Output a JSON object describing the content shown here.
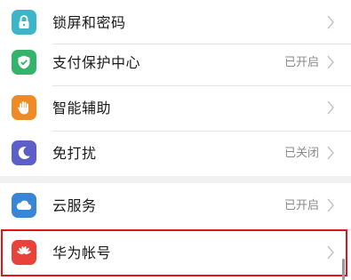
{
  "settings": {
    "items": [
      {
        "label": "锁屏和密码",
        "status": "",
        "icon": "lock-icon",
        "color": "#3cb5c9"
      },
      {
        "label": "支付保护中心",
        "status": "已开启",
        "icon": "shield-check-icon",
        "color": "#34b36a"
      },
      {
        "label": "智能辅助",
        "status": "",
        "icon": "hand-icon",
        "color": "#f08a24"
      },
      {
        "label": "免打扰",
        "status": "已关闭",
        "icon": "moon-icon",
        "color": "#5b5fc7"
      },
      {
        "label": "云服务",
        "status": "已开启",
        "icon": "cloud-icon",
        "color": "#3a86d6"
      },
      {
        "label": "华为帐号",
        "status": "",
        "icon": "huawei-logo-icon",
        "color": "#e8433a"
      }
    ]
  },
  "colors": {
    "highlight": "#e0141b",
    "chevron": "#c4c4c4",
    "status_text": "#8a8a8a"
  }
}
